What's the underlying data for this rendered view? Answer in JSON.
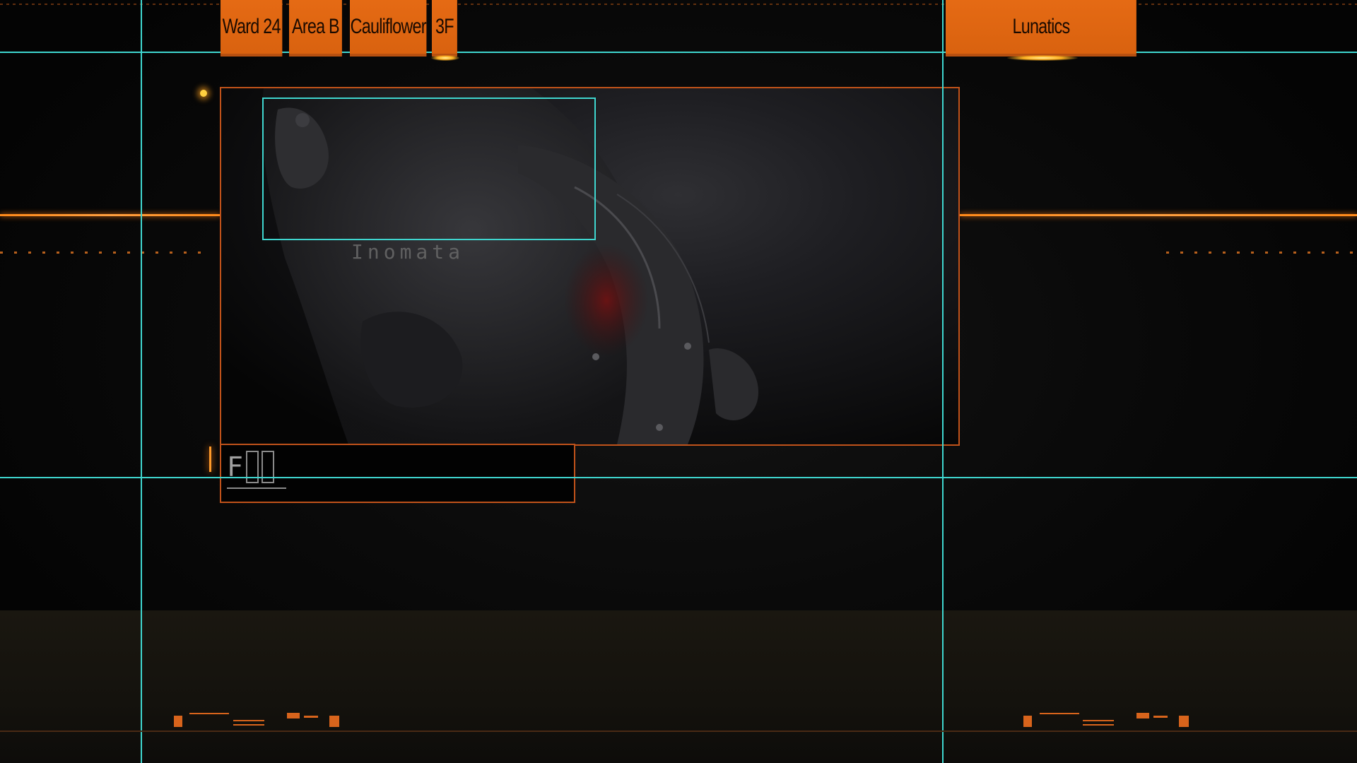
{
  "hud": {
    "tabs": [
      {
        "label": "Ward 24"
      },
      {
        "label": "Area B"
      },
      {
        "label": "Cauliflower"
      },
      {
        "label": "3F"
      }
    ],
    "right_tab": {
      "label": "Lunatics"
    }
  },
  "viewport": {
    "target_caption": "Inomata"
  },
  "textbox": {
    "glyphs": "F"
  },
  "colors": {
    "accent": "#e56a14",
    "guide": "#3fd6cf",
    "frame": "#c0521a"
  }
}
